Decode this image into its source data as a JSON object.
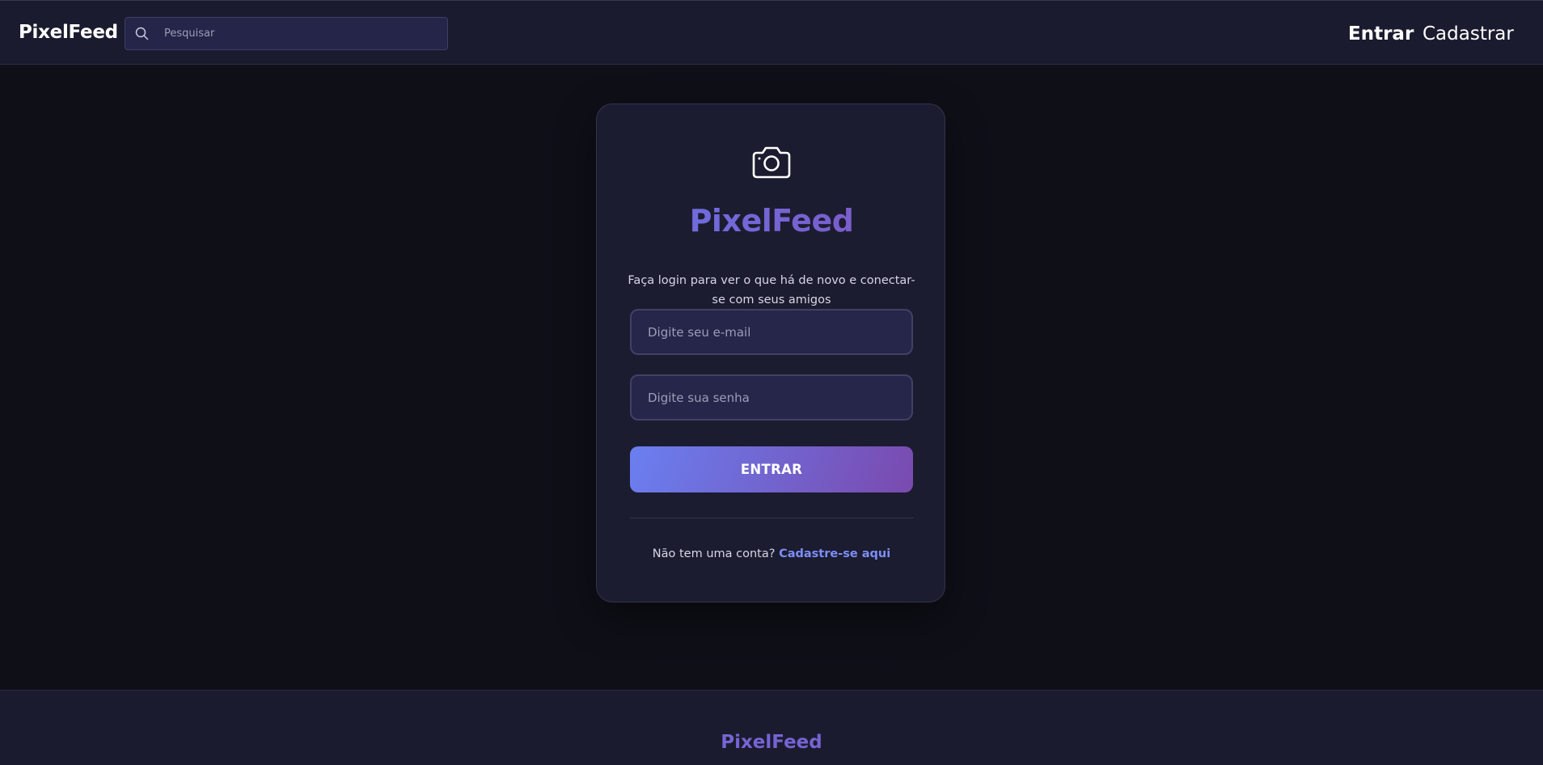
{
  "header": {
    "brand": "PixelFeed",
    "search": {
      "placeholder": "Pesquisar",
      "icon": "search-icon"
    },
    "nav": {
      "login_label": "Entrar",
      "register_label": "Cadastrar"
    }
  },
  "login_card": {
    "icon": "camera-icon",
    "title": "PixelFeed",
    "subtitle": "Faça login para ver o que há de novo e conectar-se com seus amigos",
    "email_placeholder": "Digite seu e-mail",
    "password_placeholder": "Digite sua senha",
    "submit_label": "ENTRAR",
    "signup_prompt": "Não tem uma conta?",
    "signup_link": "Cadastre-se aqui"
  },
  "footer": {
    "brand": "PixelFeed"
  },
  "colors": {
    "background": "#0f0f18",
    "surface": "#1c1c30",
    "accent_start": "#6a7ff0",
    "accent_end": "#7a4aae",
    "link": "#7c8ef5"
  }
}
